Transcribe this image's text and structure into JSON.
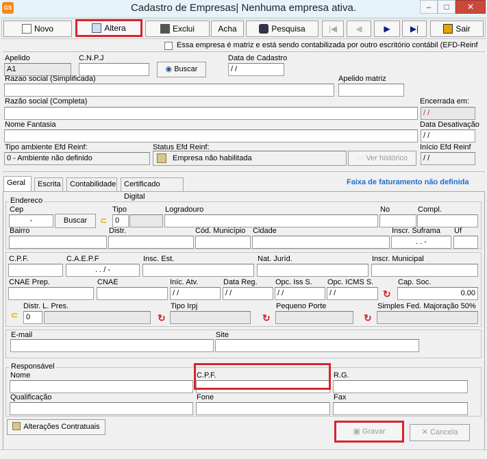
{
  "window": {
    "title": "Cadastro de Empresas| Nenhuma empresa ativa.",
    "app_icon": "GS"
  },
  "toolbar": {
    "novo": "Novo",
    "altera": "Altera",
    "exclui": "Exclui",
    "acha": "Acha",
    "pesquisa": "Pesquisa",
    "sair": "Sair"
  },
  "matriz_checkbox": "Essa empresa é matriz e está sendo contabilizada por outro escritório contábil (EFD-Reinf",
  "header": {
    "apelido_label": "Apelido",
    "apelido_value": "A1",
    "cnpj_label": "C.N.P.J",
    "buscar": "Buscar",
    "data_cadastro_label": "Data de Cadastro",
    "data_cadastro_value": "/ /",
    "razao_simplificada_label": "Razao social (Simplificada)",
    "apelido_matriz_label": "Apelido matriz",
    "razao_completa_label": "Razão social (Completa)",
    "encerrada_label": "Encerrada em:",
    "encerrada_value": "/ /",
    "nome_fantasia_label": "Nome Fantasia",
    "data_desativacao_label": "Data Desativação",
    "data_desativacao_value": "/ /",
    "tipo_ambiente_label": "Tipo ambiente Efd Reinf:",
    "tipo_ambiente_value": "0 - Ambiente não definido",
    "status_label": "Status Efd Reinf:",
    "status_value": "Empresa não habilitada",
    "ver_historico": "Ver histórico",
    "inicio_label": "Início Efd Reinf",
    "inicio_value": "/ /"
  },
  "tabs": [
    "Geral",
    "Escrita",
    "Contabilidade",
    "Certificado Digital"
  ],
  "faixa": "Faixa de faturamento não definida",
  "endereco": {
    "group": "Endereco",
    "cep": "Cep",
    "cep_value": "-",
    "buscar": "Buscar",
    "tipo": "Tipo",
    "tipo_value": "0",
    "logradouro": "Logradouro",
    "no": "No",
    "compl": "Compl.",
    "bairro": "Bairro",
    "distr": "Distr.",
    "cod_municipio": "Cód. Município",
    "cidade": "Cidade",
    "inscr_suframa": "Inscr. Suframa",
    "suframa_value": ". . -",
    "uf": "Uf"
  },
  "fiscal": {
    "cpf": "C.P.F.",
    "caepf": "C.A.E.P.F",
    "caepf_value": ". . / -",
    "insc_est": "Insc. Est.",
    "nat_jurid": "Nat. Juríd.",
    "insc_municipal": "Inscr. Municipal",
    "cnae_prep": "CNAE Prep.",
    "cnae": "CNAE",
    "inic_atv": "Iníc. Atv.",
    "inic_atv_value": "/ /",
    "data_reg": "Data Reg.",
    "data_reg_value": "/ /",
    "opc_iss": "Opc. Iss S.",
    "opc_iss_value": "/ /",
    "opc_icms": "Opc. ICMS S.",
    "opc_icms_value": "/ /",
    "cap_soc": "Cap. Soc.",
    "cap_soc_value": "0.00",
    "distr_pres": "Distr. L. Pres.",
    "distr_value": "0",
    "tipo_irpj": "Tipo Irpj",
    "pequeno_porte": "Pequeno Porte",
    "simples": "Simples Fed. Majoração 50%"
  },
  "contato": {
    "email": "E-mail",
    "site": "Site"
  },
  "responsavel": {
    "group": "Responsável",
    "nome": "Nome",
    "cpf": "C.P.F.",
    "rg": "R.G.",
    "qualificacao": "Qualificação",
    "fone": "Fone",
    "fax": "Fax"
  },
  "footer": {
    "alteracoes": "Alterações Contratuais",
    "gravar": "Gravar",
    "cancela": "Cancela"
  },
  "colors": {
    "highlight": "#d9232d",
    "faixa": "#1a6fd0"
  }
}
